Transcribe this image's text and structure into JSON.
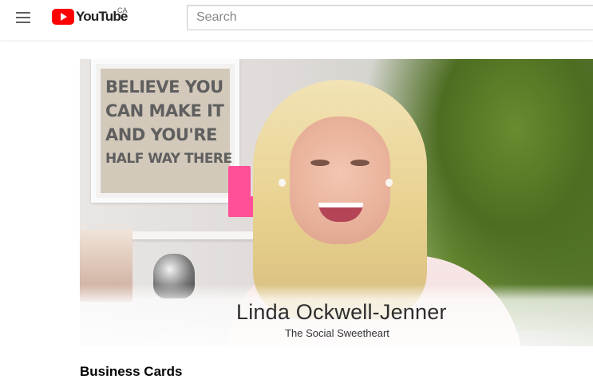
{
  "header": {
    "logo_text": "YouTube",
    "country_code": "CA",
    "search": {
      "placeholder": "Search",
      "value": ""
    },
    "icons": [
      "hamburger-menu-icon",
      "youtube-play-icon"
    ]
  },
  "video": {
    "poster_sign_lines": [
      "BELIEVE YOU",
      "CAN MAKE IT",
      "AND YOU'RE",
      "HALF WAY THERE"
    ],
    "lower_third": {
      "name": "Linda Ockwell-Jenner",
      "subtitle": "The Social Sweetheart"
    },
    "title": "Business Cards"
  },
  "colors": {
    "brand_red": "#ff0000",
    "accent_pink": "#ff4f96"
  }
}
